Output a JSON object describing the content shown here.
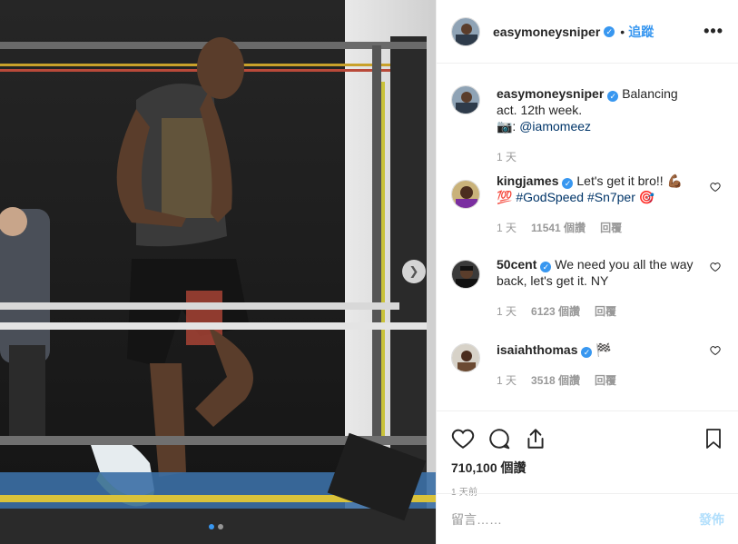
{
  "header": {
    "username": "easymoneysniper",
    "follow_label": "追蹤",
    "more_label": "•••"
  },
  "caption": {
    "username": "easymoneysniper",
    "text": "Balancing act. 12th week.",
    "photo_credit_prefix": "📷: ",
    "photo_credit_handle": "@iamomeez",
    "time": "1 天"
  },
  "comments": [
    {
      "username": "kingjames",
      "text": "Let's get it bro!! 💪🏾",
      "text2_prefix": "💯 ",
      "tags": "#GodSpeed #Sn7per",
      "text2_suffix": " 🎯",
      "time": "1 天",
      "likes": "11541 個讚",
      "reply": "回覆"
    },
    {
      "username": "50cent",
      "text": "We need you all the way back, let's get it. NY",
      "time": "1 天",
      "likes": "6123 個讚",
      "reply": "回覆"
    },
    {
      "username": "isaiahthomas",
      "text": "🏁",
      "time": "1 天",
      "likes": "3518 個讚",
      "reply": "回覆"
    }
  ],
  "post_stats": {
    "likes": "710,100 個讚",
    "time": "1 天前"
  },
  "add_comment": {
    "placeholder": "留言……",
    "post_label": "發佈"
  },
  "carousel": {
    "slide_count": 2,
    "active_slide": 1
  },
  "colors": {
    "accent": "#3897f0",
    "hashtag": "#003569",
    "muted": "#999999",
    "post_disabled": "#b2dffc"
  }
}
